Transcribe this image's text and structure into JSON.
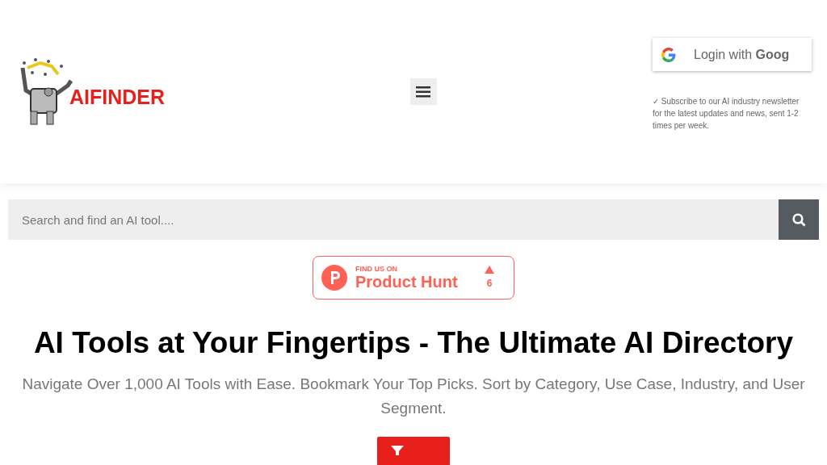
{
  "header": {
    "logo_text": "AIFINDER",
    "login_button": {
      "label": "Login with **Goog**"
    },
    "newsletter_note": "✓ Subscribe to our AI industry newsletter for the latest updates and news, sent 1-2 times per week."
  },
  "search": {
    "placeholder": "Search and find an AI tool...."
  },
  "badge": {
    "kicker": "FIND US ON",
    "title": "Product Hunt",
    "votes": "6"
  },
  "hero": {
    "title": "AI Tools at Your Fingertips - The Ultimate AI Directory",
    "subtitle": "Navigate Over 1,000 AI Tools with Ease. Bookmark Your Top Picks. Sort by Category, Use Case, Industry, and User Segment."
  }
}
